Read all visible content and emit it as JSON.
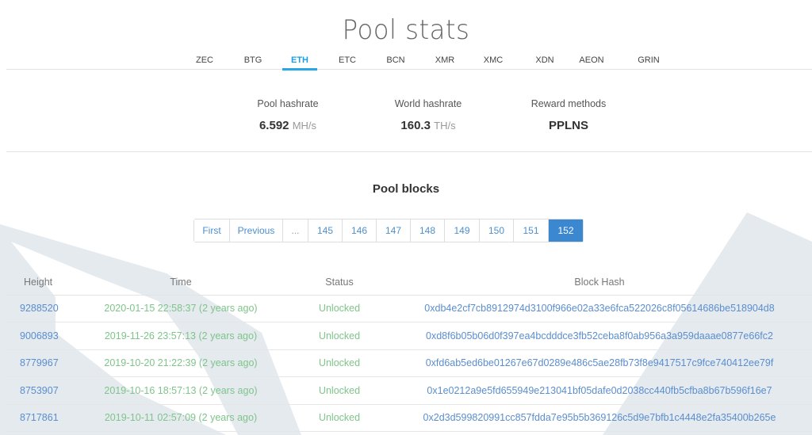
{
  "header": {
    "title": "Pool stats"
  },
  "coin_tabs": [
    {
      "label": "ZEC",
      "active": false
    },
    {
      "label": "BTG",
      "active": false
    },
    {
      "label": "ETH",
      "active": true
    },
    {
      "label": "ETC",
      "active": false
    },
    {
      "label": "BCN",
      "active": false
    },
    {
      "label": "XMR",
      "active": false
    },
    {
      "label": "XMC",
      "active": false
    },
    {
      "label": "XDN",
      "active": false
    },
    {
      "label": "AEON",
      "active": false
    },
    {
      "label": "GRIN",
      "active": false
    }
  ],
  "stats": {
    "pool_hashrate": {
      "label": "Pool hashrate",
      "value": "6.592",
      "unit": "MH/s"
    },
    "world_hashrate": {
      "label": "World hashrate",
      "value": "160.3",
      "unit": "TH/s"
    },
    "reward_methods": {
      "label": "Reward methods",
      "value": "PPLNS"
    }
  },
  "blocks": {
    "title": "Pool blocks",
    "pagination": [
      {
        "label": "First",
        "type": "nav"
      },
      {
        "label": "Previous",
        "type": "nav"
      },
      {
        "label": "...",
        "type": "ellipsis"
      },
      {
        "label": "145",
        "type": "page"
      },
      {
        "label": "146",
        "type": "page"
      },
      {
        "label": "147",
        "type": "page"
      },
      {
        "label": "148",
        "type": "page"
      },
      {
        "label": "149",
        "type": "page"
      },
      {
        "label": "150",
        "type": "page"
      },
      {
        "label": "151",
        "type": "page"
      },
      {
        "label": "152",
        "type": "page",
        "active": true
      }
    ],
    "columns": [
      "Height",
      "Time",
      "Status",
      "Block Hash"
    ],
    "rows": [
      {
        "height": "9288520",
        "time": "2020-01-15 22:58:37 (2 years ago)",
        "status": "Unlocked",
        "hash": "0xdb4e2cf7cb8912974d3100f966e02a33e6fca522026c8f05614686be518904d8"
      },
      {
        "height": "9006893",
        "time": "2019-11-26 23:57:13 (2 years ago)",
        "status": "Unlocked",
        "hash": "0xd8f6b05b06d0f397ea4bcdddce3fb52ceba8f0ab956a3a959daaae0877e66fc2"
      },
      {
        "height": "8779967",
        "time": "2019-10-20 21:22:39 (2 years ago)",
        "status": "Unlocked",
        "hash": "0xfd6ab5ed6be01267e67d0289e486c5ae28fb73f8e9417517c9fce740412ee79f"
      },
      {
        "height": "8753907",
        "time": "2019-10-16 18:57:13 (2 years ago)",
        "status": "Unlocked",
        "hash": "0x1e0212a9e5fd655949e213041bf05dafe0d2038cc440fb5cfba8b67b596f16e7"
      },
      {
        "height": "8717861",
        "time": "2019-10-11 02:57:09 (2 years ago)",
        "status": "Unlocked",
        "hash": "0x2d3d599820991cc857fdda7e95b5b369126c5d9e7bfb1c4448e2fa35400b265e"
      }
    ]
  },
  "colors": {
    "accent": "#29a8e8",
    "link": "#5b8ecf",
    "success": "#7fc48a",
    "active_page": "#3b87d0",
    "background_shape": "#e3e9ed"
  }
}
